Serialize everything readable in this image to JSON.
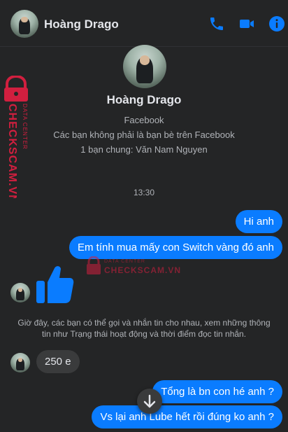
{
  "header": {
    "name": "Hoàng Drago",
    "icons": [
      "phone-icon",
      "video-camera-icon",
      "info-icon"
    ]
  },
  "profile": {
    "name": "Hoàng Drago",
    "platform": "Facebook",
    "not_friends": "Các bạn không phải là bạn bè trên Facebook",
    "mutual": "1 bạn chung: Văn Nam Nguyen"
  },
  "conversation": {
    "timestamp": "13:30",
    "messages": [
      {
        "from": "me",
        "text": "Hi anh"
      },
      {
        "from": "me",
        "text": "Em tính mua mấy con Switch vàng đó anh"
      },
      {
        "from": "them",
        "type": "like-sticker"
      },
      {
        "from": "system",
        "text": "Giờ đây, các bạn có thể gọi và nhắn tin cho nhau, xem những thông tin như Trạng thái hoạt động và thời điểm đọc tin nhắn."
      },
      {
        "from": "them",
        "text": "250 e"
      },
      {
        "from": "me",
        "text": "Tổng là bn con hé anh ?"
      },
      {
        "from": "me",
        "text": "Vs lại anh Lube hết rồi đúng ko anh ?"
      }
    ]
  },
  "watermark": {
    "line1": "DATA CENTER",
    "line2": "CHECKSCAM.VN",
    "color": "#d11f3f"
  },
  "colors": {
    "accent": "#0a7cff",
    "background": "#242526",
    "incoming_bubble": "#3a3b3c"
  }
}
